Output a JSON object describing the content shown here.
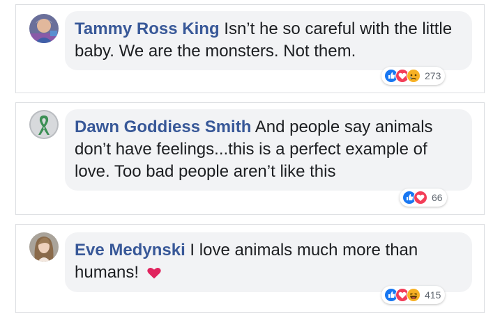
{
  "comments": [
    {
      "author": "Tammy Ross King",
      "text": "Isn’t he so careful with the little baby. We are the monsters. Not them.",
      "reaction_icons": [
        "like-icon",
        "love-icon",
        "sad-icon"
      ],
      "reaction_count": "273"
    },
    {
      "author": "Dawn Goddiess Smith",
      "text": "And people say animals don’t have feelings...this is a perfect example of love. Too bad people aren’t like this",
      "reaction_icons": [
        "like-icon",
        "love-icon"
      ],
      "reaction_count": "66"
    },
    {
      "author": "Eve Medynski",
      "text": "I love animals much more than humans!",
      "text_emoji": "heart-icon",
      "reaction_icons": [
        "like-icon",
        "love-icon",
        "haha-icon"
      ],
      "reaction_count": "415"
    }
  ],
  "colors": {
    "name": "#385898",
    "bubble": "#f2f3f5",
    "like": "#1877f2",
    "love": "#f33e58",
    "emoji_yellow": "#f7b125",
    "heart_emoji": "#e0245e"
  }
}
